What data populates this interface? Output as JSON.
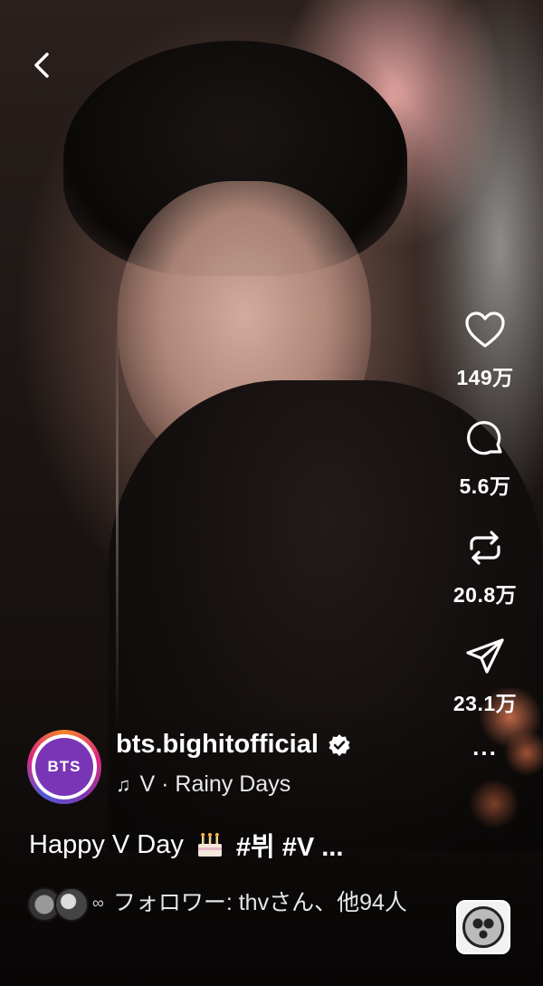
{
  "post": {
    "username": "bts.bighitofficial",
    "avatar_text": "BTS",
    "music": "V · Rainy Days",
    "caption_text": "Happy V Day",
    "caption_tags": "#뷔 #V ...",
    "followers_text": "フォロワー: thvさん、他94人"
  },
  "actions": {
    "likes": "149万",
    "comments": "5.6万",
    "reposts": "20.8万",
    "shares": "23.1万",
    "more": "..."
  },
  "colors": {
    "avatar_purple": "#7a35b6",
    "verified_white": "#ffffff"
  },
  "icons": [
    "back-icon",
    "heart-icon",
    "comment-icon",
    "repost-icon",
    "share-icon",
    "music-note-icon",
    "verified-icon",
    "cake-icon"
  ]
}
